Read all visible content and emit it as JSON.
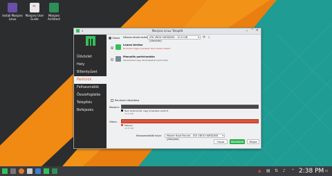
{
  "desktop": {
    "icons": [
      {
        "label": "Install Manjaro Linux",
        "icon": "install-icon",
        "color": "#6a4fa8"
      },
      {
        "label": "Manjaro User Guide",
        "icon": "pdf-guide-icon",
        "color": "#e8e8e8"
      },
      {
        "label": "Manjaro Architect",
        "icon": "architect-icon",
        "color": "#2f8f5a"
      }
    ]
  },
  "window": {
    "title": "Manjaro Linux Telepítő",
    "sidebar": [
      {
        "label": "Üdvözlet",
        "active": false
      },
      {
        "label": "Hely",
        "active": false
      },
      {
        "label": "Billentyűzet",
        "active": false
      },
      {
        "label": "Partíciók",
        "active": true
      },
      {
        "label": "Felhasználók",
        "active": false
      },
      {
        "label": "Összefoglalás",
        "active": false
      },
      {
        "label": "Telepítés",
        "active": false
      },
      {
        "label": "Befejezés",
        "active": false
      }
    ],
    "content": {
      "back_label": "Vissza",
      "device_label": "Válassz tároló eszközt:",
      "device_value": "ATA VBOX HARDDISK - 10.0 GiB (/dev/sda)",
      "options": [
        {
          "title": "Lemez törlése",
          "desc": "Ez törölni fogja a lemezen lévő összes adatot.",
          "selected": true
        },
        {
          "title": "Manuális partícionálás",
          "desc": "Létrehozhat vagy átméretezhet partíciókat.",
          "selected": false
        }
      ],
      "encrypt_label": "Rendszer titkosítása",
      "before_label": "Mostani:",
      "before_legend": "Nem particionált, vagy ismeretlen partíció",
      "before_size": "10.0 GiB",
      "after_label": "Utána:",
      "after_legend": "Manjaro",
      "after_size": "10.0 GiB",
      "bootloader_label": "Rendszerbetöltő helye:",
      "bootloader_value": "Master Boot Record - ATA VBOX HARDDISK (/dev/sda)",
      "buttons": {
        "back": "Vissza",
        "next": "Következő",
        "cancel": "Mégse"
      }
    }
  },
  "taskbar": {
    "clock": "2:38 PM"
  },
  "colors": {
    "accent": "#35bf5c",
    "active": "#e0533a",
    "after_bar": "#e0533a"
  }
}
